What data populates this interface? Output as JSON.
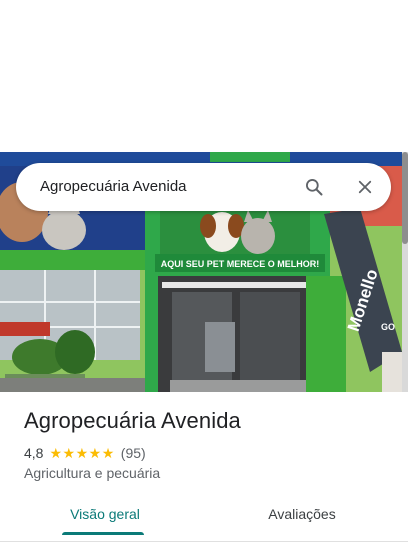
{
  "search": {
    "query": "Agropecuária Avenida",
    "search_icon": "search-icon",
    "close_icon": "close-icon"
  },
  "photo": {
    "storefront_banner": "AQUI SEU PET MERECE O MELHOR!",
    "sign_brand": "Monello",
    "sign_brand_sub": "GO"
  },
  "place": {
    "name": "Agropecuária Avenida",
    "rating": "4,8",
    "rating_stars": 5,
    "review_count": "(95)",
    "category": "Agricultura e pecuária"
  },
  "tabs": [
    {
      "label": "Visão geral",
      "selected": true
    },
    {
      "label": "Avaliações",
      "selected": false
    }
  ],
  "colors": {
    "accent": "#0b7a78",
    "star": "#fbbc04",
    "store_green": "#2fa84a"
  }
}
